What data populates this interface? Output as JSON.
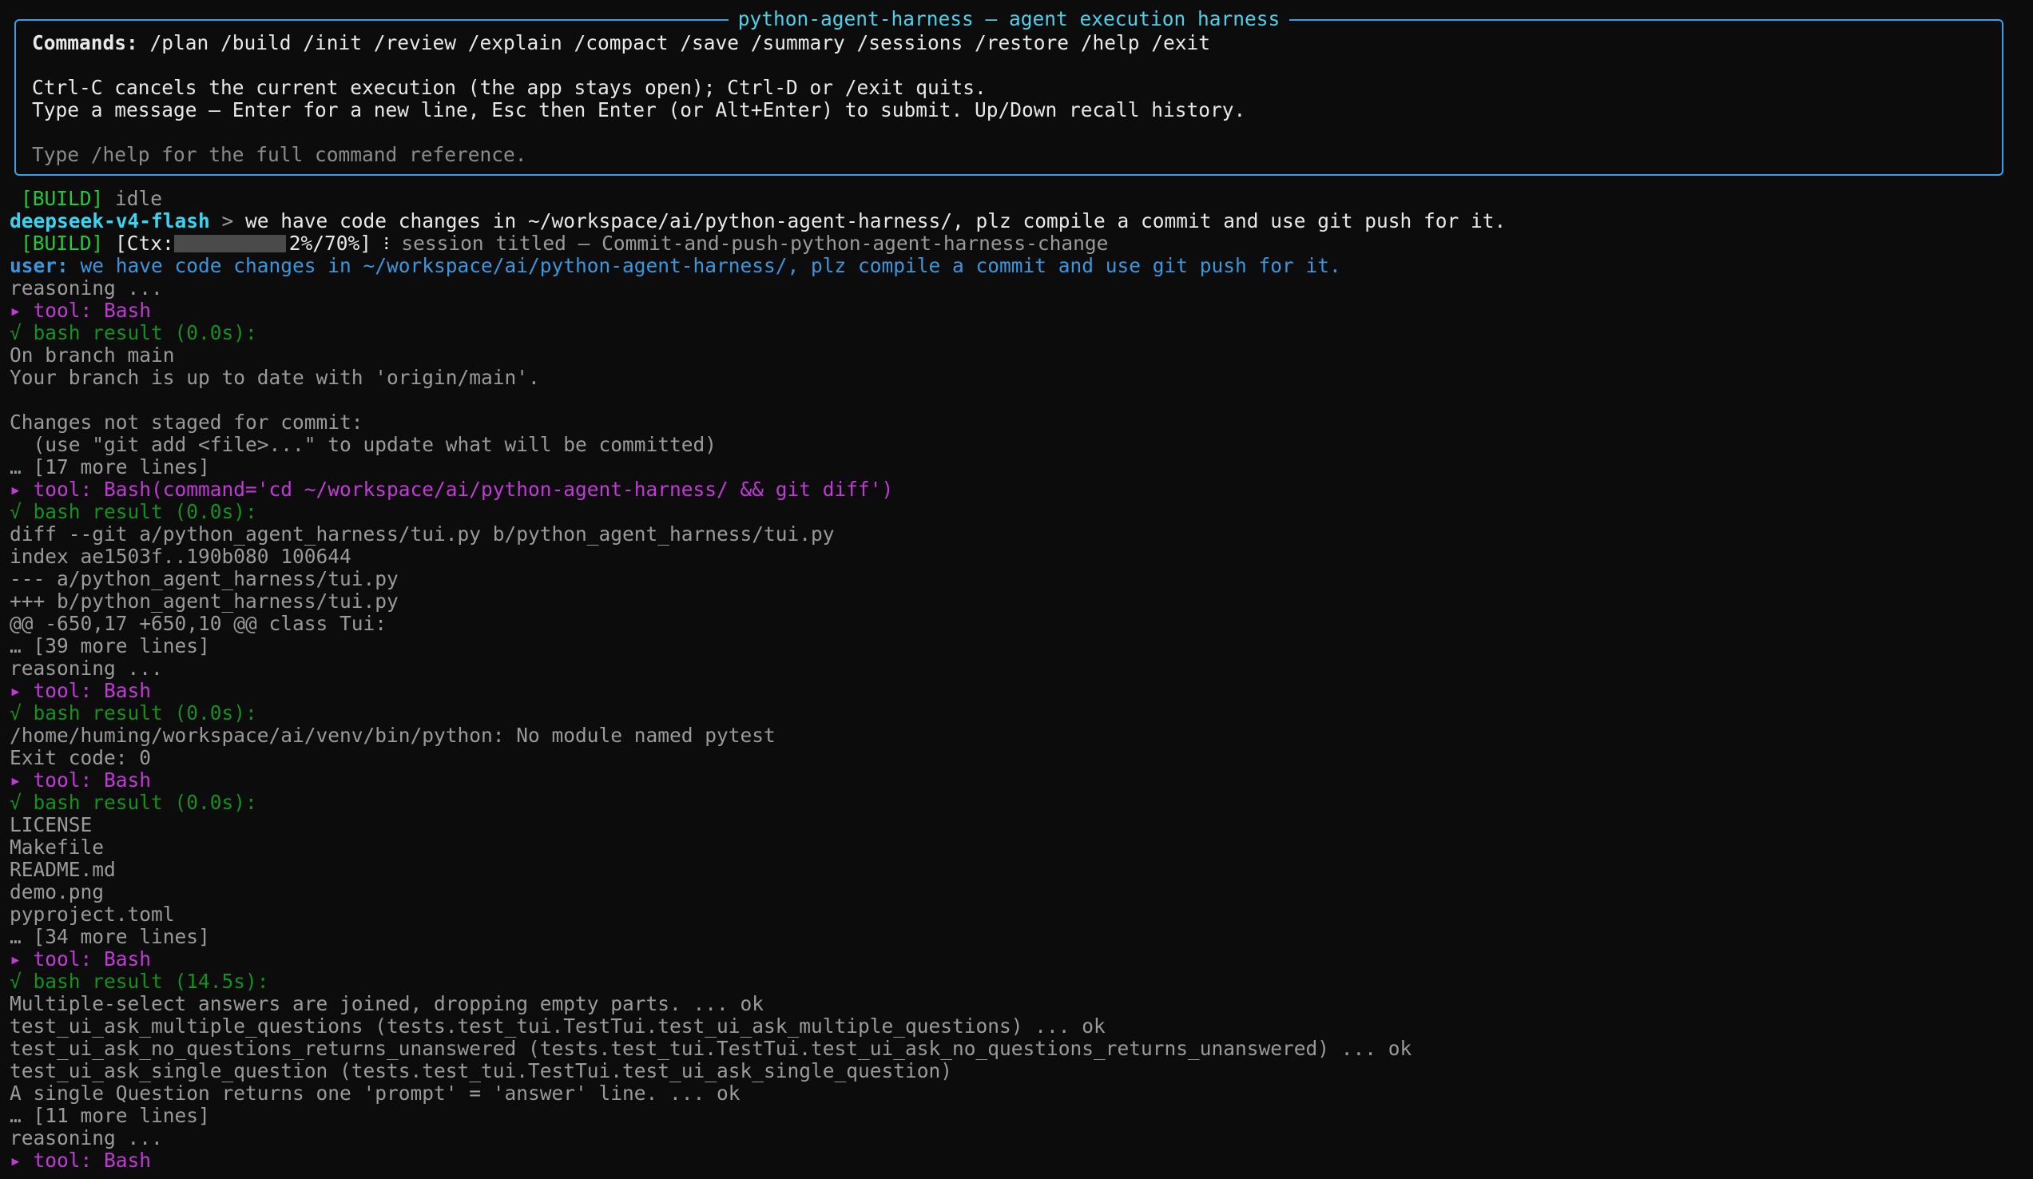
{
  "header": {
    "title": "python-agent-harness — agent execution harness",
    "commands_label": "Commands:",
    "commands": " /plan /build /init /review /explain /compact /save /summary /sessions /restore /help /exit",
    "info_line_1": "Ctrl-C cancels the current execution (the app stays open); Ctrl-D or /exit quits.",
    "info_line_2": "Type a message — Enter for a new line, Esc then Enter (or Alt+Enter) to submit. Up/Down recall history.",
    "help_hint": "Type /help for the full command reference."
  },
  "status_idle": {
    "mode": "[BUILD]",
    "state": " idle"
  },
  "prompt": {
    "model": "deepseek-v4-flash",
    "arrow": " > ",
    "text": "we have code changes in ~/workspace/ai/python-agent-harness/, plz compile a commit and use git push for it."
  },
  "status_ctx": {
    "mode": "[BUILD]",
    "ctx_label": "[Ctx:",
    "ctx_value": "2%/70%]",
    "ctx_fraction": 0.02,
    "separator": " ⁝ ",
    "session_text": "session titled — Commit-and-push-python-agent-harness-change"
  },
  "user_msg": {
    "label": "user:",
    "text": " we have code changes in ~/workspace/ai/python-agent-harness/, plz compile a commit and use git push for it."
  },
  "log": [
    {
      "t": "reasoning ...",
      "c": "gray"
    },
    {
      "t": "▸ tool: Bash",
      "c": "magenta"
    },
    {
      "t": "√ bash result (0.0s):",
      "c": "dkgreen"
    },
    {
      "t": "On branch main",
      "c": "gray"
    },
    {
      "t": "Your branch is up to date with 'origin/main'.",
      "c": "gray"
    },
    {
      "t": "",
      "c": "gray"
    },
    {
      "t": "Changes not staged for commit:",
      "c": "gray"
    },
    {
      "t": "  (use \"git add <file>...\" to update what will be committed)",
      "c": "gray"
    },
    {
      "t": "… [17 more lines]",
      "c": "gray"
    },
    {
      "t": "▸ tool: Bash(command='cd ~/workspace/ai/python-agent-harness/ && git diff')",
      "c": "magenta"
    },
    {
      "t": "√ bash result (0.0s):",
      "c": "dkgreen"
    },
    {
      "t": "diff --git a/python_agent_harness/tui.py b/python_agent_harness/tui.py",
      "c": "gray"
    },
    {
      "t": "index ae1503f..190b080 100644",
      "c": "gray"
    },
    {
      "t": "--- a/python_agent_harness/tui.py",
      "c": "gray"
    },
    {
      "t": "+++ b/python_agent_harness/tui.py",
      "c": "gray"
    },
    {
      "t": "@@ -650,17 +650,10 @@ class Tui:",
      "c": "gray"
    },
    {
      "t": "… [39 more lines]",
      "c": "gray"
    },
    {
      "t": "reasoning ...",
      "c": "gray"
    },
    {
      "t": "▸ tool: Bash",
      "c": "magenta"
    },
    {
      "t": "√ bash result (0.0s):",
      "c": "dkgreen"
    },
    {
      "t": "/home/huming/workspace/ai/venv/bin/python: No module named pytest",
      "c": "gray"
    },
    {
      "t": "Exit code: 0",
      "c": "gray"
    },
    {
      "t": "▸ tool: Bash",
      "c": "magenta"
    },
    {
      "t": "√ bash result (0.0s):",
      "c": "dkgreen"
    },
    {
      "t": "LICENSE",
      "c": "gray"
    },
    {
      "t": "Makefile",
      "c": "gray"
    },
    {
      "t": "README.md",
      "c": "gray"
    },
    {
      "t": "demo.png",
      "c": "gray"
    },
    {
      "t": "pyproject.toml",
      "c": "gray"
    },
    {
      "t": "… [34 more lines]",
      "c": "gray"
    },
    {
      "t": "▸ tool: Bash",
      "c": "magenta"
    },
    {
      "t": "√ bash result (14.5s):",
      "c": "dkgreen"
    },
    {
      "t": "Multiple-select answers are joined, dropping empty parts. ... ok",
      "c": "gray"
    },
    {
      "t": "test_ui_ask_multiple_questions (tests.test_tui.TestTui.test_ui_ask_multiple_questions) ... ok",
      "c": "gray"
    },
    {
      "t": "test_ui_ask_no_questions_returns_unanswered (tests.test_tui.TestTui.test_ui_ask_no_questions_returns_unanswered) ... ok",
      "c": "gray"
    },
    {
      "t": "test_ui_ask_single_question (tests.test_tui.TestTui.test_ui_ask_single_question)",
      "c": "gray"
    },
    {
      "t": "A single Question returns one 'prompt' = 'answer' line. ... ok",
      "c": "gray"
    },
    {
      "t": "… [11 more lines]",
      "c": "gray"
    },
    {
      "t": "reasoning ...",
      "c": "gray"
    },
    {
      "t": "▸ tool: Bash",
      "c": "magenta"
    }
  ]
}
